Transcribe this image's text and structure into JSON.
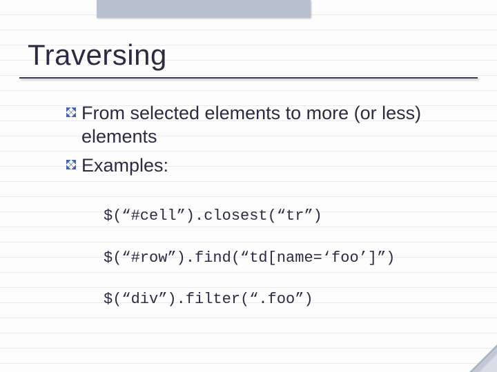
{
  "slide": {
    "title": "Traversing",
    "bullets": [
      "From selected elements to more (or less) elements",
      "Examples:"
    ],
    "code": [
      "$(“#cell”).closest(“tr”)",
      "$(“#row”).find(“td[name=‘foo’]”)",
      "$(“div”).filter(“.foo”)"
    ]
  }
}
